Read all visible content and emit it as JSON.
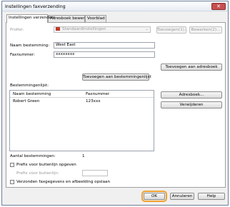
{
  "window": {
    "title": "Instellingen faxverzending",
    "close": "✕"
  },
  "tabs": [
    "Instellingen verzenden",
    "Adresboek bewerken",
    "Voorblad"
  ],
  "profile": {
    "label": "Profiel:",
    "value": "Standaardinstellingen",
    "add": "Toevoegen(1)...",
    "edit": "Bewerken(2)..."
  },
  "recipient": {
    "name_label": "Naam bestemming:",
    "name_value": "West East",
    "fax_label": "Faxnummer:",
    "fax_value": "xxxxxxxx"
  },
  "buttons": {
    "add_to_addressbook": "Toevoegen aan adresboek",
    "add_to_list": "Toevoegen aan bestemmingenlijst",
    "addressbook": "Adresboek...",
    "remove": "Verwijderen",
    "ok": "OK",
    "cancel": "Annuleren",
    "help": "Help"
  },
  "list": {
    "label": "Bestemmingenlijst:",
    "columns": [
      "Naam bestemming",
      "Faxnummer"
    ],
    "rows": [
      {
        "name": "Robert Green",
        "fax": "123xxx"
      }
    ]
  },
  "count": {
    "label": "Aantal bestemmingen:",
    "value": "1"
  },
  "options": {
    "prefix_check": "Prefix voor buitenlijn opgeven",
    "prefix_field": "Prefix voor buitenlijn:",
    "save_check": "Verzonden faxgegevens en afbeelding opslaan"
  }
}
